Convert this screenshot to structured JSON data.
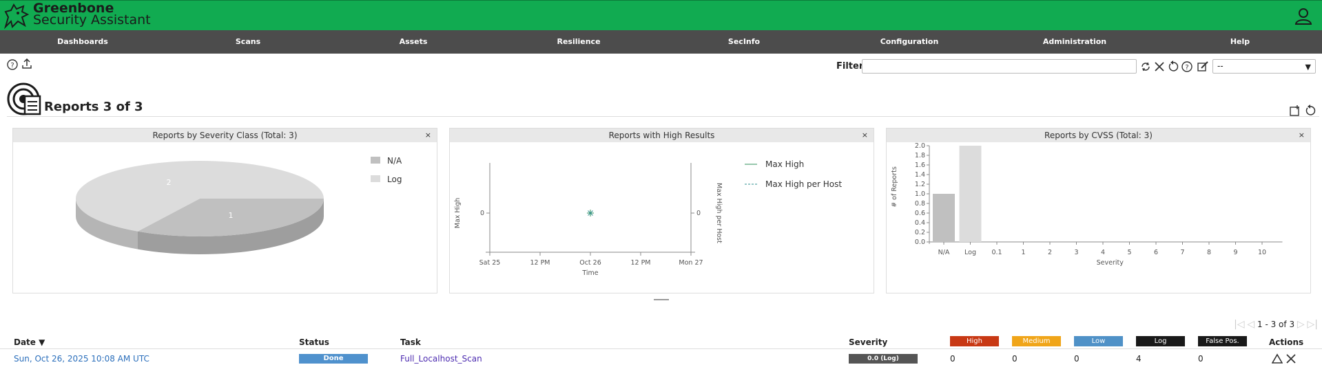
{
  "app": {
    "brand_line1": "Greenbone",
    "brand_line2": "Security Assistant"
  },
  "menu": [
    {
      "label": "Dashboards"
    },
    {
      "label": "Scans"
    },
    {
      "label": "Assets"
    },
    {
      "label": "Resilience"
    },
    {
      "label": "SecInfo"
    },
    {
      "label": "Configuration"
    },
    {
      "label": "Administration"
    },
    {
      "label": "Help"
    }
  ],
  "filter": {
    "label": "Filter",
    "value": "",
    "selected": "--"
  },
  "page": {
    "title": "Reports 3 of 3"
  },
  "panels": [
    {
      "title": "Reports by Severity Class (Total: 3)"
    },
    {
      "title": "Reports with High Results"
    },
    {
      "title": "Reports by CVSS (Total: 3)"
    }
  ],
  "close_glyph": "×",
  "chart_data": [
    {
      "type": "pie",
      "title": "Reports by Severity Class (Total: 3)",
      "categories": [
        "N/A",
        "Log"
      ],
      "values": [
        1,
        2
      ],
      "colors": [
        "#c0c0c0",
        "#dcdcdc"
      ],
      "legend": "right"
    },
    {
      "type": "line",
      "title": "Reports with High Results",
      "xlabel": "Time",
      "ylabel": "Max High",
      "ylabel_right": "Max High per Host",
      "x_ticks": [
        "Sat 25",
        "12 PM",
        "Oct 26",
        "12 PM",
        "Mon 27"
      ],
      "y_ticks": [
        "0"
      ],
      "y2_ticks": [
        "0"
      ],
      "series": [
        {
          "name": "Max High",
          "x": [
            "Oct 26"
          ],
          "values": [
            0
          ],
          "color": "#2f8f5b"
        },
        {
          "name": "Max High per Host",
          "x": [
            "Oct 26"
          ],
          "values": [
            0
          ],
          "color": "#2f8f8f",
          "dashed": true
        }
      ],
      "legend": "right"
    },
    {
      "type": "bar",
      "title": "Reports by CVSS (Total: 3)",
      "xlabel": "Severity",
      "ylabel": "# of Reports",
      "categories": [
        "N/A",
        "Log",
        "0.1",
        "1",
        "2",
        "3",
        "4",
        "5",
        "6",
        "7",
        "8",
        "9",
        "10"
      ],
      "values": [
        1,
        2,
        0,
        0,
        0,
        0,
        0,
        0,
        0,
        0,
        0,
        0,
        0
      ],
      "ylim": [
        0,
        2.0
      ],
      "y_ticks": [
        "0.0",
        "0.2",
        "0.4",
        "0.6",
        "0.8",
        "1.0",
        "1.2",
        "1.4",
        "1.6",
        "1.8",
        "2.0"
      ],
      "colors": [
        "#c0c0c0",
        "#dcdcdc"
      ]
    }
  ],
  "pager": {
    "text": "1 - 3 of 3"
  },
  "table": {
    "columns": {
      "date": "Date ▼",
      "status": "Status",
      "task": "Task",
      "severity": "Severity",
      "actions": "Actions"
    },
    "severity_badges": [
      {
        "label": "High",
        "color": "#c83814"
      },
      {
        "label": "Medium",
        "color": "#f0a519"
      },
      {
        "label": "Low",
        "color": "#4f91c7"
      },
      {
        "label": "Log",
        "color": "#191919"
      },
      {
        "label": "False Pos.",
        "color": "#191919"
      }
    ],
    "rows": [
      {
        "date": "Sun, Oct 26, 2025 10:08 AM UTC",
        "status": "Done",
        "task": "Full_Localhost_Scan",
        "severity": "0.0 (Log)",
        "high": "0",
        "medium": "0",
        "low": "0",
        "log": "4",
        "false_pos": "0"
      }
    ]
  }
}
